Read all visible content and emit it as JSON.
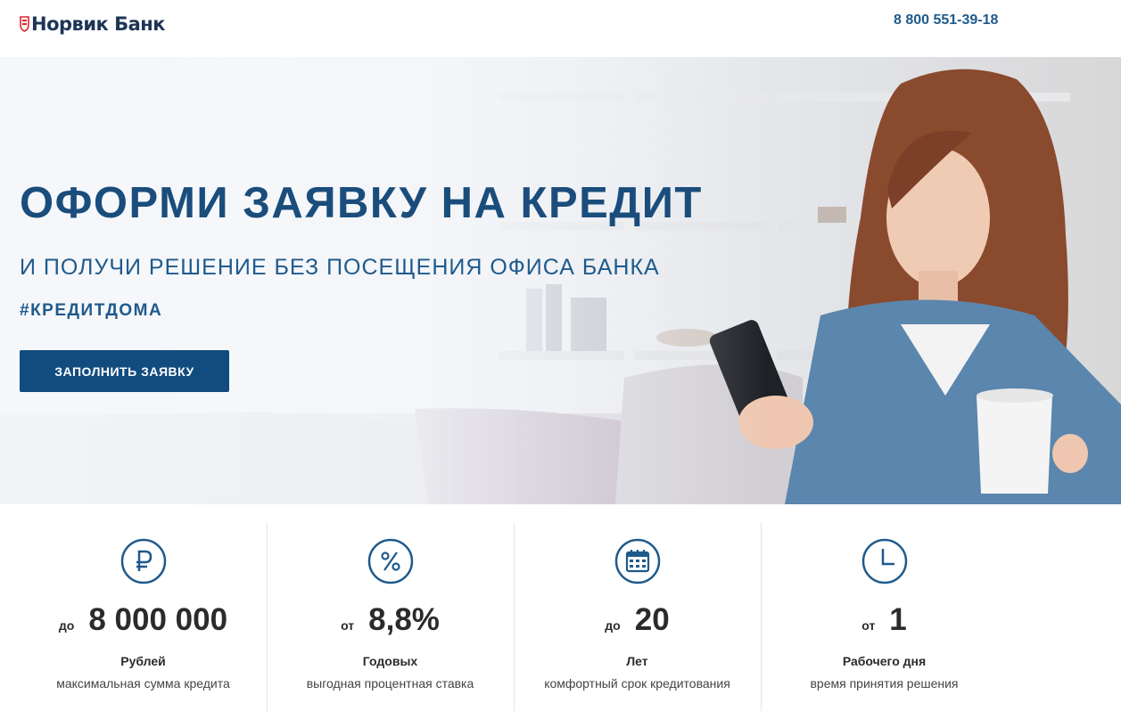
{
  "header": {
    "logo_text": "Норвик Банк",
    "phone": "8 800 551-39-18"
  },
  "hero": {
    "title": "ОФОРМИ ЗАЯВКУ НА КРЕДИТ",
    "subtitle": "И ПОЛУЧИ РЕШЕНИЕ БЕЗ ПОСЕЩЕНИЯ ОФИСА БАНКА",
    "hashtag": "#КРЕДИТДОМА",
    "button_label": "ЗАПОЛНИТЬ ЗАЯВКУ"
  },
  "features": [
    {
      "icon": "ruble-icon",
      "prefix": "до",
      "value": "8 000 000",
      "unit": "Рублей",
      "description": "максимальная сумма кредита"
    },
    {
      "icon": "percent-icon",
      "prefix": "от",
      "value": "8,8%",
      "unit": "Годовых",
      "description": "выгодная процентная ставка"
    },
    {
      "icon": "calendar-icon",
      "prefix": "до",
      "value": "20",
      "unit": "Лет",
      "description": "комфортный срок кредитования"
    },
    {
      "icon": "clock-icon",
      "prefix": "от",
      "value": "1",
      "unit": "Рабочего дня",
      "description": "время принятия решения"
    }
  ],
  "colors": {
    "brand_blue": "#124c7f",
    "heading_blue": "#1a4d7c",
    "icon_blue": "#1f5a8c",
    "logo_red": "#d9262c"
  }
}
